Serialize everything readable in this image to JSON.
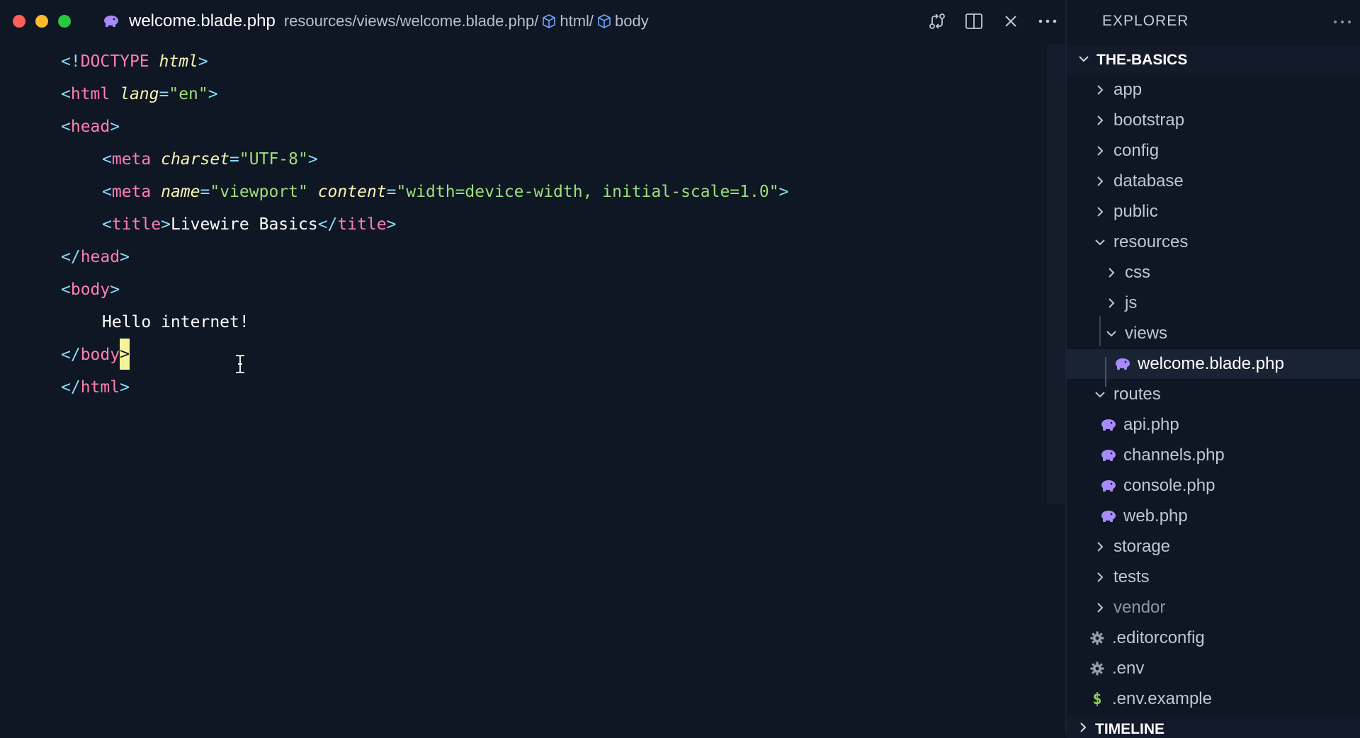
{
  "window": {
    "tab_title": "welcome.blade.php",
    "tab_icon": "php-elephant-icon",
    "breadcrumb": {
      "path": "resources/views/welcome.blade.php",
      "sep": "/",
      "html": "html",
      "body": "body"
    }
  },
  "title_actions": [
    {
      "name": "open-changes-icon"
    },
    {
      "name": "split-editor-icon"
    },
    {
      "name": "close-icon"
    },
    {
      "name": "more-actions-icon"
    }
  ],
  "editor": {
    "lines": {
      "l1": {
        "lt": "<!",
        "kw": "DOCTYPE",
        "sp": " ",
        "attr": "html",
        "gt": ">"
      },
      "l2": {
        "lt": "<",
        "tag": "html",
        "sp": " ",
        "attr": "lang",
        "eq": "=",
        "val": "\"en\"",
        "gt": ">"
      },
      "l3": {
        "lt": "<",
        "tag": "head",
        "gt": ">"
      },
      "l4": {
        "lt": "<",
        "tag": "meta",
        "sp": " ",
        "attr": "charset",
        "eq": "=",
        "val": "\"UTF-8\"",
        "gt": ">"
      },
      "l5": {
        "lt": "<",
        "tag": "meta",
        "sp": " ",
        "attr1": "name",
        "eq1": "=",
        "val1": "\"viewport\"",
        "sp2": " ",
        "attr2": "content",
        "eq2": "=",
        "val2": "\"width=device-width, initial-scale=1.0\"",
        "gt": ">"
      },
      "l6": {
        "lt": "<",
        "tag": "title",
        "gt": ">",
        "text": "Livewire Basics",
        "lt2": "</",
        "tag2": "title",
        "gt2": ">"
      },
      "l7": {
        "lt": "</",
        "tag": "head",
        "gt": ">"
      },
      "l8": {
        "lt": "<",
        "tag": "body",
        "gt": ">"
      },
      "l9": {
        "text": "Hello internet!"
      },
      "l10": {
        "lt": "</",
        "tag": "body",
        "gt": ">"
      },
      "l11": {
        "lt": "</",
        "tag": "html",
        "gt": ">"
      }
    }
  },
  "explorer": {
    "title": "EXPLORER",
    "project": "THE-BASICS",
    "items": {
      "app": "app",
      "bootstrap": "bootstrap",
      "config": "config",
      "database": "database",
      "public": "public",
      "resources": "resources",
      "css": "css",
      "js": "js",
      "views": "views",
      "welcome": "welcome.blade.php",
      "routes": "routes",
      "api": "api.php",
      "channels": "channels.php",
      "console": "console.php",
      "web": "web.php",
      "storage": "storage",
      "tests": "tests",
      "vendor": "vendor",
      "editorconfig": ".editorconfig",
      "env": ".env",
      "env_example": ".env.example"
    },
    "env_example_icon_glyph": "$",
    "timeline": "TIMELINE"
  },
  "colors": {
    "background": "#0f1624",
    "tag": "#ff7fb0",
    "punct": "#89ddff",
    "attr": "#f5f7b5",
    "string": "#9be07a",
    "php_icon": "#a78bfa",
    "cursor": "#f6f39a"
  }
}
